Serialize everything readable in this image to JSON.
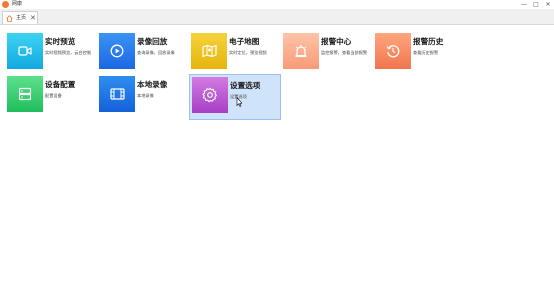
{
  "app": {
    "title": "网康"
  },
  "window": {
    "minimize_glyph": "—",
    "maximize_glyph": "□",
    "close_glyph": "✕"
  },
  "tab": {
    "label": "主页",
    "close_glyph": "✕",
    "icon": "home-icon"
  },
  "tiles": [
    {
      "title": "实时预览",
      "subtitle": "实时视频预览，云台控制",
      "icon": "camera-icon",
      "color_top": "#3fd3f2",
      "color_bottom": "#11a9e0"
    },
    {
      "title": "录像回放",
      "subtitle": "查询录像，回放录像",
      "icon": "play-icon",
      "color_top": "#3a94f5",
      "color_bottom": "#1c67e4"
    },
    {
      "title": "电子地图",
      "subtitle": "实时定位，预览视频",
      "icon": "map-icon",
      "color_top": "#f5d23c",
      "color_bottom": "#e5b50d"
    },
    {
      "title": "报警中心",
      "subtitle": "监控报警，查看当前报警",
      "icon": "alarm-icon",
      "color_top": "#ffc4a7",
      "color_bottom": "#f89a77"
    },
    {
      "title": "报警历史",
      "subtitle": "查看历史报警",
      "icon": "history-icon",
      "color_top": "#ffa67e",
      "color_bottom": "#f1754d"
    },
    {
      "title": "设备配置",
      "subtitle": "配置设备",
      "icon": "device-icon",
      "color_top": "#5ee08c",
      "color_bottom": "#1fbe5c"
    },
    {
      "title": "本地录像",
      "subtitle": "本地录像",
      "icon": "film-icon",
      "color_top": "#2f8ef0",
      "color_bottom": "#1561d9"
    },
    {
      "title": "设置选项",
      "subtitle": "设置选项",
      "icon": "gear-icon",
      "color_top": "#d37ae3",
      "color_bottom": "#a73fc6"
    }
  ]
}
